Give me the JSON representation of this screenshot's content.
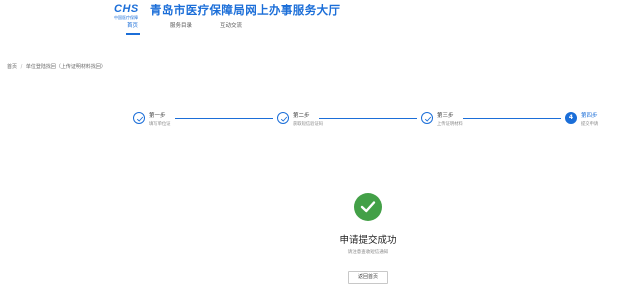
{
  "header": {
    "logo_text": "CHS",
    "logo_subtext": "中国医疗保障",
    "site_title": "青岛市医疗保障局网上办事服务大厅",
    "nav": [
      {
        "label": "首页",
        "active": true
      },
      {
        "label": "服务目录",
        "active": false
      },
      {
        "label": "互动交流",
        "active": false
      }
    ]
  },
  "breadcrumb": {
    "home": "首页",
    "separator": "/",
    "current": "单位登陆找回（上传证明材料找回）"
  },
  "steps": [
    {
      "title": "第一步",
      "subtitle": "填写单位证",
      "status": "done"
    },
    {
      "title": "第二步",
      "subtitle": "获取短信验证码",
      "status": "done"
    },
    {
      "title": "第三步",
      "subtitle": "上传证明材料",
      "status": "done"
    },
    {
      "title": "第四步",
      "subtitle": "提交申请",
      "status": "current",
      "number": "4"
    }
  ],
  "result": {
    "title": "申请提交成功",
    "subtitle": "请注意查收短信通知",
    "button_label": "返回首页",
    "icon": "check-icon"
  },
  "colors": {
    "accent": "#1b6ed8",
    "success": "#43a047"
  }
}
